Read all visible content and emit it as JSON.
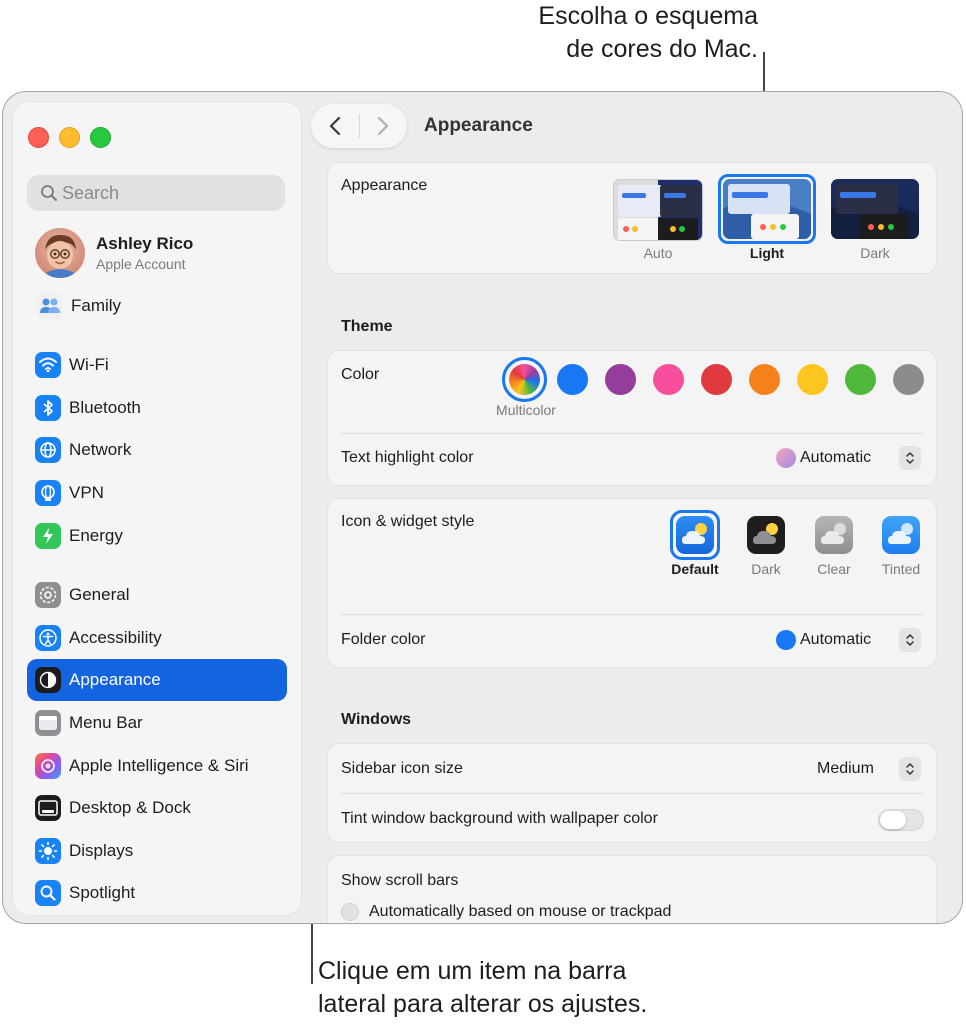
{
  "callouts": {
    "top_line1": "Escolha o esquema",
    "top_line2": "de cores do Mac.",
    "bottom_line1": "Clique em um item na barra",
    "bottom_line2": "lateral para alterar os ajustes."
  },
  "window": {
    "title": "Appearance",
    "traffic_lights": [
      "close",
      "minimize",
      "zoom"
    ]
  },
  "sidebar": {
    "search_placeholder": "Search",
    "account": {
      "name": "Ashley Rico",
      "subtitle": "Apple Account"
    },
    "items": [
      {
        "label": "Family",
        "icon": "family-icon"
      },
      {
        "label": "Wi-Fi",
        "icon": "wifi-icon"
      },
      {
        "label": "Bluetooth",
        "icon": "bluetooth-icon"
      },
      {
        "label": "Network",
        "icon": "network-icon"
      },
      {
        "label": "VPN",
        "icon": "vpn-icon"
      },
      {
        "label": "Energy",
        "icon": "energy-icon"
      },
      {
        "label": "General",
        "icon": "gear-icon"
      },
      {
        "label": "Accessibility",
        "icon": "accessibility-icon"
      },
      {
        "label": "Appearance",
        "icon": "appearance-icon",
        "selected": true
      },
      {
        "label": "Menu Bar",
        "icon": "menu-bar-icon"
      },
      {
        "label": "Apple Intelligence & Siri",
        "icon": "siri-icon"
      },
      {
        "label": "Desktop & Dock",
        "icon": "dock-icon"
      },
      {
        "label": "Displays",
        "icon": "displays-icon"
      },
      {
        "label": "Spotlight",
        "icon": "spotlight-icon"
      }
    ]
  },
  "appearance": {
    "label": "Appearance",
    "options": [
      "Auto",
      "Light",
      "Dark"
    ],
    "selected": "Light"
  },
  "theme": {
    "title": "Theme",
    "color_label": "Color",
    "colors": [
      {
        "name": "Multicolor",
        "hex": "multicolor",
        "selected": true
      },
      {
        "name": "Blue",
        "hex": "#1877f2"
      },
      {
        "name": "Purple",
        "hex": "#953d9b"
      },
      {
        "name": "Pink",
        "hex": "#f74f9e"
      },
      {
        "name": "Red",
        "hex": "#e0393e"
      },
      {
        "name": "Orange",
        "hex": "#f7821b"
      },
      {
        "name": "Yellow",
        "hex": "#fcc520"
      },
      {
        "name": "Green",
        "hex": "#50b83c"
      },
      {
        "name": "Graphite",
        "hex": "#8c8c8c"
      }
    ],
    "selected_color_caption": "Multicolor",
    "text_highlight_label": "Text highlight color",
    "text_highlight_value": "Automatic"
  },
  "icon_style": {
    "label": "Icon & widget style",
    "options": [
      "Default",
      "Dark",
      "Clear",
      "Tinted"
    ],
    "selected": "Default",
    "folder_color_label": "Folder color",
    "folder_color_value": "Automatic"
  },
  "windows": {
    "title": "Windows",
    "sidebar_icon_size_label": "Sidebar icon size",
    "sidebar_icon_size_value": "Medium",
    "tint_label": "Tint window background with wallpaper color",
    "tint_enabled": false
  },
  "scroll_bars": {
    "label": "Show scroll bars",
    "option1": "Automatically based on mouse or trackpad"
  }
}
